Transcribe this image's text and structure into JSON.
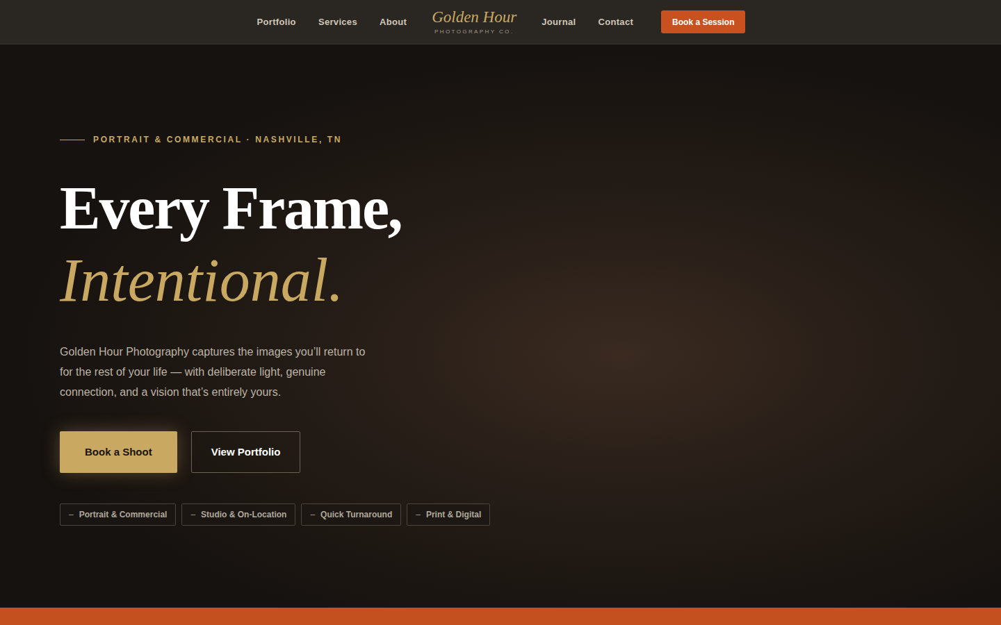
{
  "nav": {
    "left_items": [
      {
        "label": "Portfolio"
      },
      {
        "label": "Services"
      },
      {
        "label": "About"
      }
    ],
    "logo": {
      "title": "Golden Hour",
      "subtitle": "PHOTOGRAPHY CO."
    },
    "right_items": [
      {
        "label": "Journal"
      },
      {
        "label": "Contact"
      }
    ],
    "cta": "Book a Session"
  },
  "hero": {
    "eyebrow": "PORTRAIT & COMMERCIAL · NASHVILLE, TN",
    "heading_line1": "Every Frame,",
    "heading_line2": "Intentional.",
    "paragraph": "Golden Hour Photography captures the images you’ll return to for the rest of your life — with deliberate light, genuine connection, and a vision that’s entirely yours.",
    "buttons": [
      {
        "label": "Book a Shoot",
        "kind": "primary"
      },
      {
        "label": "View Portfolio",
        "kind": "outline"
      }
    ],
    "tags": [
      {
        "marker": "–",
        "label": "Portrait & Commercial"
      },
      {
        "marker": "–",
        "label": "Studio & On-Location"
      },
      {
        "marker": "–",
        "label": "Quick Turnaround"
      },
      {
        "marker": "–",
        "label": "Print & Digital"
      }
    ]
  }
}
